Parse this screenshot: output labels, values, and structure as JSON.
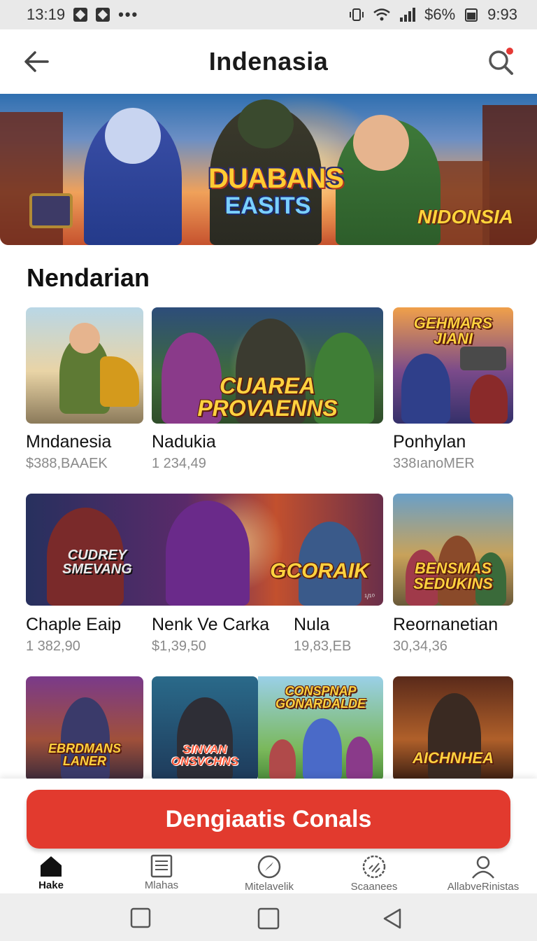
{
  "status_bar": {
    "time": "13:19",
    "more": "•••",
    "battery": "$6%",
    "clock": "9:93"
  },
  "header": {
    "title": "Indenasia",
    "back_icon": "arrow-left-icon",
    "search_icon": "search-icon",
    "has_notification": true
  },
  "banner": {
    "logo_line1": "DUABANS",
    "logo_line2": "EASITS",
    "tag": "NIDONSIA"
  },
  "section": {
    "title": "Nendarian"
  },
  "rows": [
    {
      "tiles": [
        {
          "label": ""
        },
        {
          "label": "CUAREA PROVAENNS"
        },
        {
          "label": "GEHMARS JIANI"
        }
      ],
      "items": [
        {
          "name": "Mndanesia",
          "price": "$388,BAAEK"
        },
        {
          "name": "Nadukia",
          "price": "1 234,49"
        },
        {
          "name": "Ponhylan",
          "price": "338ıanoMER"
        }
      ]
    },
    {
      "tiles": [
        {
          "label": "CUDREY SMEVANG"
        },
        {
          "label": "GCORAIK"
        },
        {
          "label": "BENSMAS SEDUKINS"
        }
      ],
      "small_tag": "¹/¹⁰",
      "items": [
        {
          "name": "Chaple Eaip",
          "price": "1 382,90"
        },
        {
          "name": "Nenk Ve Carka",
          "price": "$1,39,50"
        },
        {
          "name": "Nula",
          "price": "19,83,EB"
        },
        {
          "name": "Reornanetian",
          "price": "30,34,36"
        }
      ]
    },
    {
      "tiles": [
        {
          "label": "EBRDMANS LANER"
        },
        {
          "label": "SINVAN ONSVCHNS"
        },
        {
          "label": "CONSPNAP GONARDALDE"
        },
        {
          "label": "AICHNHEA"
        }
      ]
    }
  ],
  "cta": {
    "label": "Dengiaatis Conals"
  },
  "bottom_nav": [
    {
      "label": "Hake",
      "icon": "home-icon",
      "active": true
    },
    {
      "label": "Mlahas",
      "icon": "document-icon",
      "active": false
    },
    {
      "label": "Mitelavelik",
      "icon": "compass-icon",
      "active": false
    },
    {
      "label": "Scaanees",
      "icon": "badge-icon",
      "active": false
    },
    {
      "label": "AllabveRinistas",
      "icon": "user-icon",
      "active": false
    }
  ],
  "colors": {
    "accent": "#e23a2e",
    "notification": "#e53935",
    "price": "#8a8a8a"
  }
}
